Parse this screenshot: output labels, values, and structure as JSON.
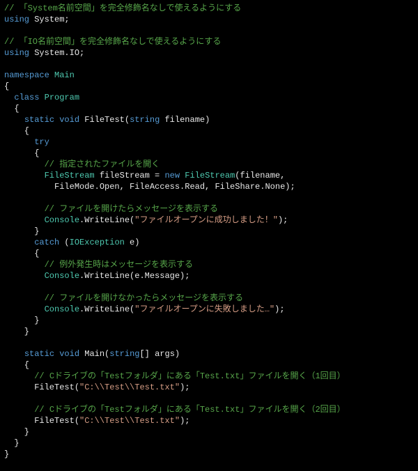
{
  "code": {
    "lines": [
      [
        {
          "cls": "c-comment",
          "t": "// 「System名前空間」を完全修飾名なしで使えるようにする"
        }
      ],
      [
        {
          "cls": "c-keyword",
          "t": "using"
        },
        {
          "cls": "c-plain",
          "t": " System;"
        }
      ],
      [],
      [
        {
          "cls": "c-comment",
          "t": "// 「IO名前空間」を完全修飾名なしで使えるようにする"
        }
      ],
      [
        {
          "cls": "c-keyword",
          "t": "using"
        },
        {
          "cls": "c-plain",
          "t": " System.IO;"
        }
      ],
      [],
      [
        {
          "cls": "c-keyword",
          "t": "namespace"
        },
        {
          "cls": "c-plain",
          "t": " "
        },
        {
          "cls": "c-type",
          "t": "Main"
        }
      ],
      [
        {
          "cls": "c-plain",
          "t": "{"
        }
      ],
      [
        {
          "cls": "c-plain",
          "t": "  "
        },
        {
          "cls": "c-keyword",
          "t": "class"
        },
        {
          "cls": "c-plain",
          "t": " "
        },
        {
          "cls": "c-type",
          "t": "Program"
        }
      ],
      [
        {
          "cls": "c-plain",
          "t": "  {"
        }
      ],
      [
        {
          "cls": "c-plain",
          "t": "    "
        },
        {
          "cls": "c-keyword",
          "t": "static"
        },
        {
          "cls": "c-plain",
          "t": " "
        },
        {
          "cls": "c-keyword",
          "t": "void"
        },
        {
          "cls": "c-plain",
          "t": " FileTest("
        },
        {
          "cls": "c-keyword",
          "t": "string"
        },
        {
          "cls": "c-plain",
          "t": " filename)"
        }
      ],
      [
        {
          "cls": "c-plain",
          "t": "    {"
        }
      ],
      [
        {
          "cls": "c-plain",
          "t": "      "
        },
        {
          "cls": "c-keyword",
          "t": "try"
        }
      ],
      [
        {
          "cls": "c-plain",
          "t": "      {"
        }
      ],
      [
        {
          "cls": "c-plain",
          "t": "        "
        },
        {
          "cls": "c-comment",
          "t": "// 指定されたファイルを開く"
        }
      ],
      [
        {
          "cls": "c-plain",
          "t": "        "
        },
        {
          "cls": "c-type",
          "t": "FileStream"
        },
        {
          "cls": "c-plain",
          "t": " fileStream = "
        },
        {
          "cls": "c-keyword",
          "t": "new"
        },
        {
          "cls": "c-plain",
          "t": " "
        },
        {
          "cls": "c-type",
          "t": "FileStream"
        },
        {
          "cls": "c-plain",
          "t": "(filename,"
        }
      ],
      [
        {
          "cls": "c-plain",
          "t": "          FileMode.Open, FileAccess.Read, FileShare.None);"
        }
      ],
      [],
      [
        {
          "cls": "c-plain",
          "t": "        "
        },
        {
          "cls": "c-comment",
          "t": "// ファイルを開けたらメッセージを表示する"
        }
      ],
      [
        {
          "cls": "c-plain",
          "t": "        "
        },
        {
          "cls": "c-type",
          "t": "Console"
        },
        {
          "cls": "c-plain",
          "t": ".WriteLine("
        },
        {
          "cls": "c-string",
          "t": "\"ファイルオープンに成功しました！\""
        },
        {
          "cls": "c-plain",
          "t": ");"
        }
      ],
      [
        {
          "cls": "c-plain",
          "t": "      }"
        }
      ],
      [
        {
          "cls": "c-plain",
          "t": "      "
        },
        {
          "cls": "c-keyword",
          "t": "catch"
        },
        {
          "cls": "c-plain",
          "t": " ("
        },
        {
          "cls": "c-type",
          "t": "IOException"
        },
        {
          "cls": "c-plain",
          "t": " e)"
        }
      ],
      [
        {
          "cls": "c-plain",
          "t": "      {"
        }
      ],
      [
        {
          "cls": "c-plain",
          "t": "        "
        },
        {
          "cls": "c-comment",
          "t": "// 例外発生時はメッセージを表示する"
        }
      ],
      [
        {
          "cls": "c-plain",
          "t": "        "
        },
        {
          "cls": "c-type",
          "t": "Console"
        },
        {
          "cls": "c-plain",
          "t": ".WriteLine(e.Message);"
        }
      ],
      [],
      [
        {
          "cls": "c-plain",
          "t": "        "
        },
        {
          "cls": "c-comment",
          "t": "// ファイルを開けなかったらメッセージを表示する"
        }
      ],
      [
        {
          "cls": "c-plain",
          "t": "        "
        },
        {
          "cls": "c-type",
          "t": "Console"
        },
        {
          "cls": "c-plain",
          "t": ".WriteLine("
        },
        {
          "cls": "c-string",
          "t": "\"ファイルオープンに失敗しました…\""
        },
        {
          "cls": "c-plain",
          "t": ");"
        }
      ],
      [
        {
          "cls": "c-plain",
          "t": "      }"
        }
      ],
      [
        {
          "cls": "c-plain",
          "t": "    }"
        }
      ],
      [],
      [
        {
          "cls": "c-plain",
          "t": "    "
        },
        {
          "cls": "c-keyword",
          "t": "static"
        },
        {
          "cls": "c-plain",
          "t": " "
        },
        {
          "cls": "c-keyword",
          "t": "void"
        },
        {
          "cls": "c-plain",
          "t": " Main("
        },
        {
          "cls": "c-keyword",
          "t": "string"
        },
        {
          "cls": "c-plain",
          "t": "[] args)"
        }
      ],
      [
        {
          "cls": "c-plain",
          "t": "    {"
        }
      ],
      [
        {
          "cls": "c-plain",
          "t": "      "
        },
        {
          "cls": "c-comment",
          "t": "// Cドライブの「Testフォルダ」にある「Test.txt」ファイルを開く（1回目）"
        }
      ],
      [
        {
          "cls": "c-plain",
          "t": "      FileTest("
        },
        {
          "cls": "c-string",
          "t": "\"C:\\\\Test\\\\Test.txt\""
        },
        {
          "cls": "c-plain",
          "t": ");"
        }
      ],
      [],
      [
        {
          "cls": "c-plain",
          "t": "      "
        },
        {
          "cls": "c-comment",
          "t": "// Cドライブの「Testフォルダ」にある「Test.txt」ファイルを開く（2回目）"
        }
      ],
      [
        {
          "cls": "c-plain",
          "t": "      FileTest("
        },
        {
          "cls": "c-string",
          "t": "\"C:\\\\Test\\\\Test.txt\""
        },
        {
          "cls": "c-plain",
          "t": ");"
        }
      ],
      [
        {
          "cls": "c-plain",
          "t": "    }"
        }
      ],
      [
        {
          "cls": "c-plain",
          "t": "  }"
        }
      ],
      [
        {
          "cls": "c-plain",
          "t": "}"
        }
      ]
    ]
  }
}
